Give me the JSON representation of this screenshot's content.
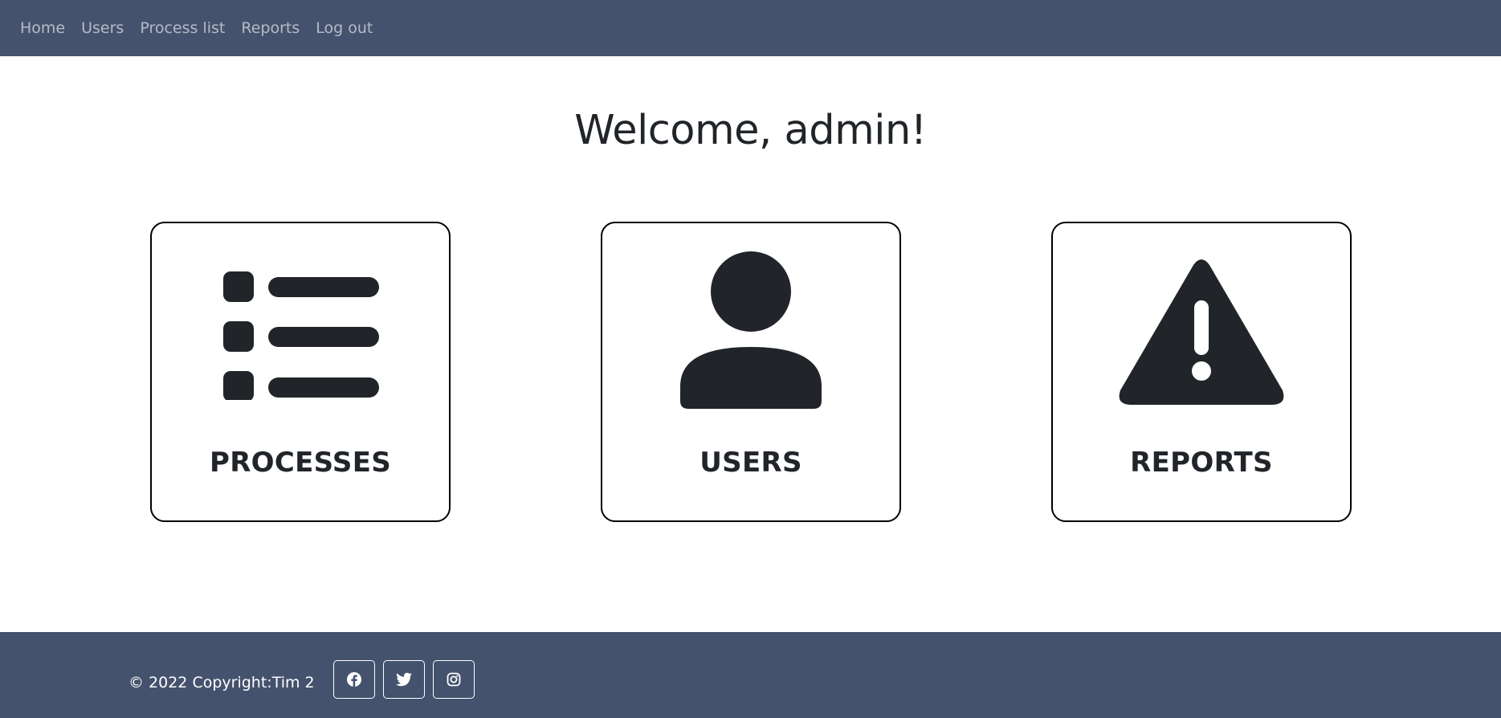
{
  "navbar": {
    "links": [
      {
        "label": "Home"
      },
      {
        "label": "Users"
      },
      {
        "label": "Process list"
      },
      {
        "label": "Reports"
      },
      {
        "label": "Log out"
      }
    ]
  },
  "main": {
    "welcome": "Welcome, admin!",
    "cards": [
      {
        "label": "PROCESSES",
        "icon": "list-icon"
      },
      {
        "label": "USERS",
        "icon": "person-icon"
      },
      {
        "label": "REPORTS",
        "icon": "warning-triangle-icon"
      }
    ]
  },
  "footer": {
    "copyright_symbol": "©",
    "year": "2022",
    "copyright_text": "Copyright:",
    "owner": "Tim 2",
    "social": [
      {
        "icon": "facebook-icon"
      },
      {
        "icon": "twitter-icon"
      },
      {
        "icon": "instagram-icon"
      }
    ]
  },
  "colors": {
    "navbar_bg": "#45526e",
    "footer_bg": "#45526e",
    "text_dark": "#212529",
    "card_border": "#000000"
  }
}
